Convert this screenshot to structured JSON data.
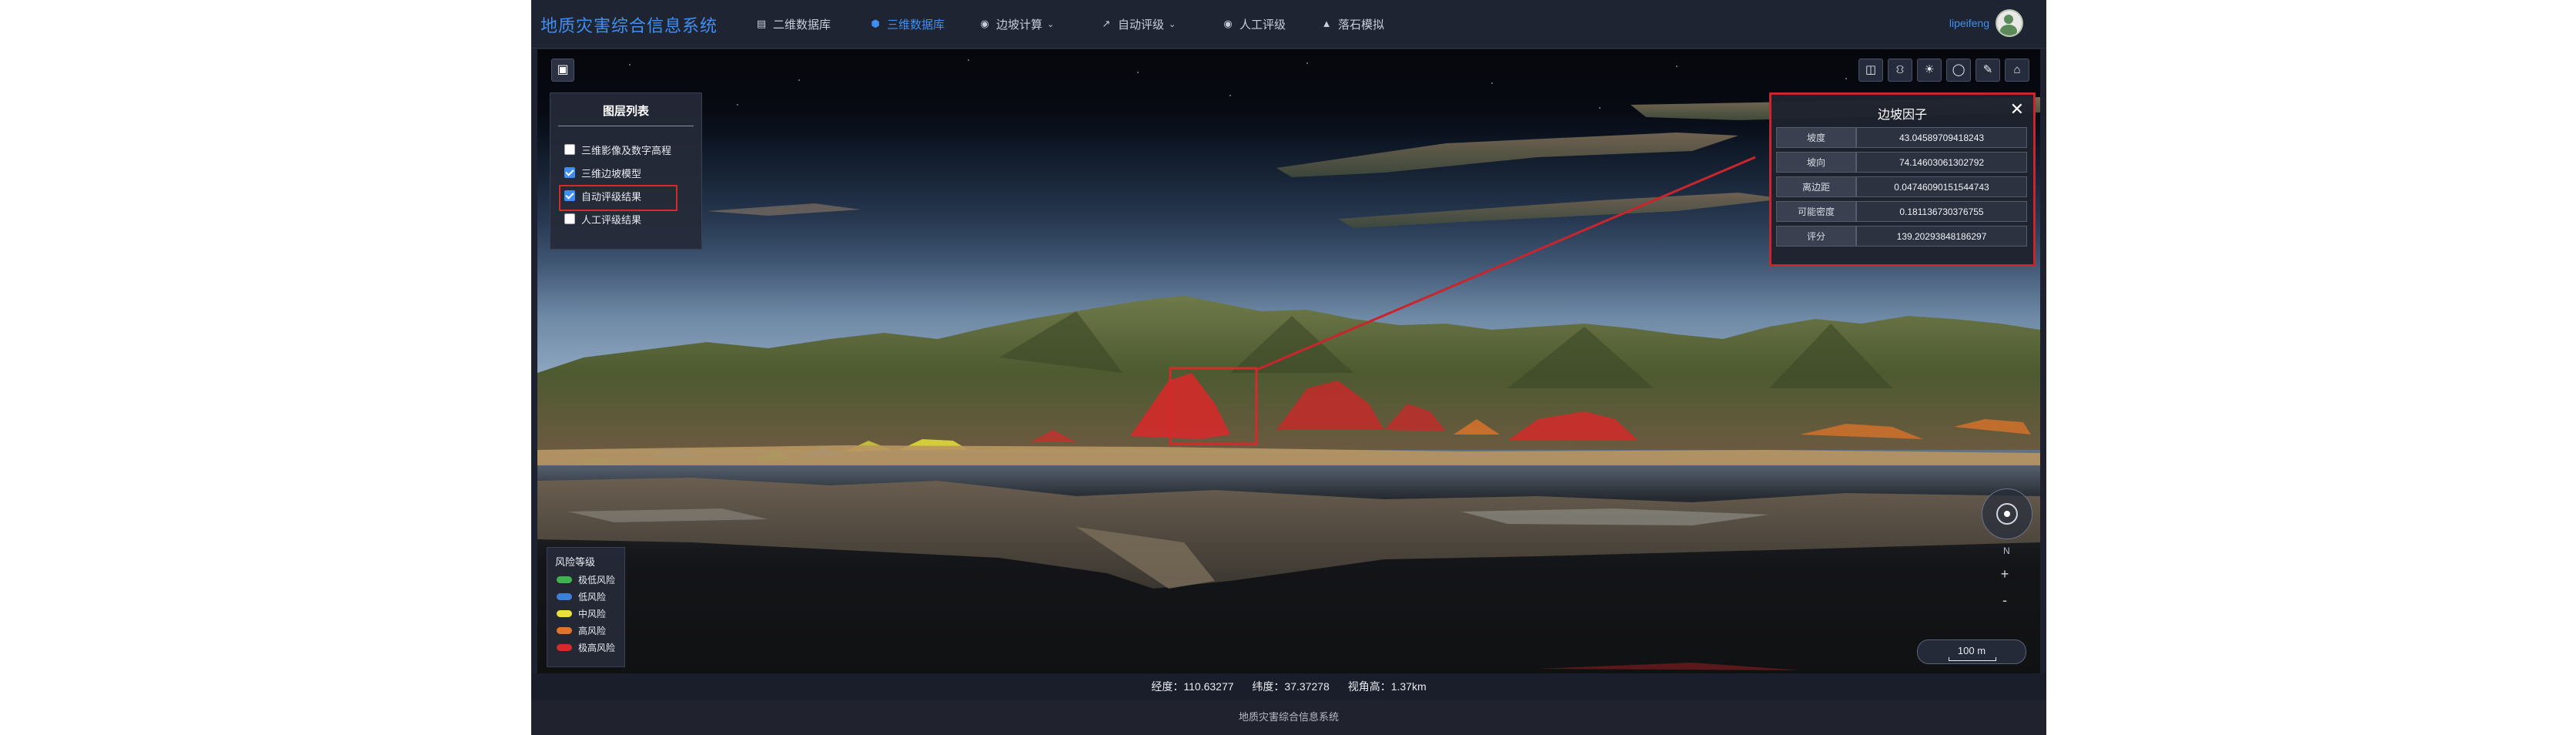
{
  "header": {
    "title": "地质灾害综合信息系统",
    "nav": [
      {
        "label": "二维数据库",
        "icon": "layers-icon",
        "active": false,
        "dropdown": false
      },
      {
        "label": "三维数据库",
        "icon": "cube-icon",
        "active": true,
        "dropdown": false
      },
      {
        "label": "边坡计算",
        "icon": "calculator-icon",
        "active": false,
        "dropdown": true
      },
      {
        "label": "自动评级",
        "icon": "trend-icon",
        "active": false,
        "dropdown": true
      },
      {
        "label": "人工评级",
        "icon": "eye-icon",
        "active": false,
        "dropdown": false
      },
      {
        "label": "落石模拟",
        "icon": "rock-icon",
        "active": false,
        "dropdown": false
      }
    ],
    "user": "lipeifeng"
  },
  "layer_panel": {
    "title": "图层列表",
    "items": [
      {
        "label": "三维影像及数字高程",
        "checked": false
      },
      {
        "label": "三维边坡模型",
        "checked": true
      },
      {
        "label": "自动评级结果",
        "checked": true
      },
      {
        "label": "人工评级结果",
        "checked": false
      }
    ]
  },
  "factor_panel": {
    "title": "边坡因子",
    "rows": [
      {
        "key": "坡度",
        "value": "43.04589709418243"
      },
      {
        "key": "坡向",
        "value": "74.14603061302792"
      },
      {
        "key": "离边距",
        "value": "0.04746090151544743"
      },
      {
        "key": "可能密度",
        "value": "0.181136730376755"
      },
      {
        "key": "评分",
        "value": "139.20293848186297"
      }
    ]
  },
  "legend": {
    "title": "风险等级",
    "items": [
      {
        "label": "极低风险",
        "color": "#3fb34f"
      },
      {
        "label": "低风险",
        "color": "#3b7fd8"
      },
      {
        "label": "中风险",
        "color": "#e8e23a"
      },
      {
        "label": "高风险",
        "color": "#e0742a"
      },
      {
        "label": "极高风险",
        "color": "#d42a2a"
      }
    ]
  },
  "compass": {
    "north_label": "N"
  },
  "zoom": {
    "in": "+",
    "out": "-"
  },
  "scale": "100 m",
  "status": {
    "longitude": "经度：110.63277",
    "latitude": "纬度：37.37278",
    "height": "视角高：1.37km"
  },
  "footer": "地质灾害综合信息系统",
  "colors": {
    "accent": "#3f8ff2",
    "highlight": "#d42a2a"
  }
}
